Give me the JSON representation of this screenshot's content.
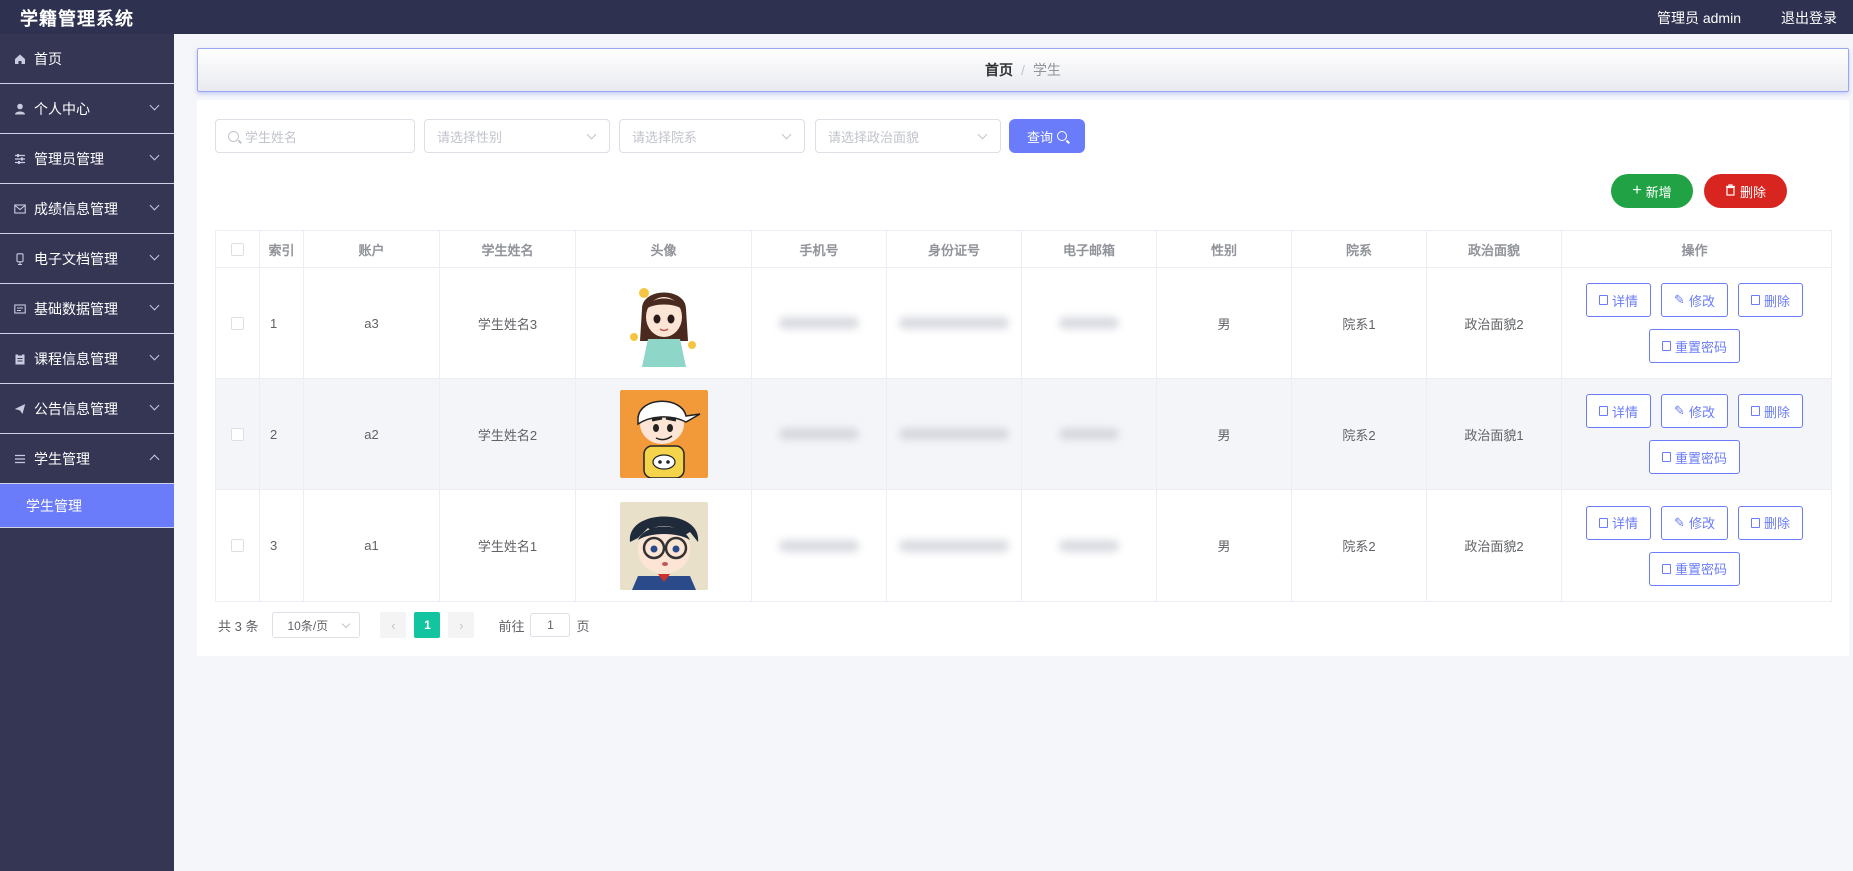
{
  "header": {
    "app_title": "学籍管理系统",
    "user": "管理员 admin",
    "logout": "退出登录"
  },
  "sidebar": {
    "items": [
      {
        "label": "首页",
        "icon": "home-icon",
        "expandable": false
      },
      {
        "label": "个人中心",
        "icon": "user-icon",
        "expandable": true
      },
      {
        "label": "管理员管理",
        "icon": "sliders-icon",
        "expandable": true
      },
      {
        "label": "成绩信息管理",
        "icon": "mail-icon",
        "expandable": true
      },
      {
        "label": "电子文档管理",
        "icon": "document-icon",
        "expandable": true
      },
      {
        "label": "基础数据管理",
        "icon": "card-icon",
        "expandable": true
      },
      {
        "label": "课程信息管理",
        "icon": "clipboard-icon",
        "expandable": true
      },
      {
        "label": "公告信息管理",
        "icon": "send-icon",
        "expandable": true
      },
      {
        "label": "学生管理",
        "icon": "list-icon",
        "expandable": true,
        "expanded": true
      }
    ],
    "active_sub": "学生管理"
  },
  "breadcrumb": {
    "home": "首页",
    "separator": "/",
    "current": "学生"
  },
  "search": {
    "name_placeholder": "学生姓名",
    "gender_placeholder": "请选择性别",
    "dept_placeholder": "请选择院系",
    "politics_placeholder": "请选择政治面貌",
    "query_label": "查询"
  },
  "actions": {
    "add_label": "新增",
    "delete_label": "删除"
  },
  "table": {
    "columns": [
      "索引",
      "账户",
      "学生姓名",
      "头像",
      "手机号",
      "身份证号",
      "电子邮箱",
      "性别",
      "院系",
      "政治面貌",
      "操作"
    ],
    "rows": [
      {
        "index": "1",
        "account": "a3",
        "name": "学生姓名3",
        "gender": "男",
        "dept": "院系1",
        "politics": "政治面貌2"
      },
      {
        "index": "2",
        "account": "a2",
        "name": "学生姓名2",
        "gender": "男",
        "dept": "院系2",
        "politics": "政治面貌1"
      },
      {
        "index": "3",
        "account": "a1",
        "name": "学生姓名1",
        "gender": "男",
        "dept": "院系2",
        "politics": "政治面貌2"
      }
    ],
    "op_labels": {
      "detail": "详情",
      "edit": "修改",
      "delete": "删除",
      "reset": "重置密码"
    }
  },
  "pager": {
    "total": "共 3 条",
    "page_size": "10条/页",
    "current_page": "1",
    "goto": "前往",
    "goto_value": "1",
    "page_unit": "页"
  },
  "colors": {
    "sidebar": "#353654",
    "accent": "#6a7cf9",
    "add": "#21a345",
    "delete": "#d9251f",
    "page_active": "#13c4a0"
  }
}
